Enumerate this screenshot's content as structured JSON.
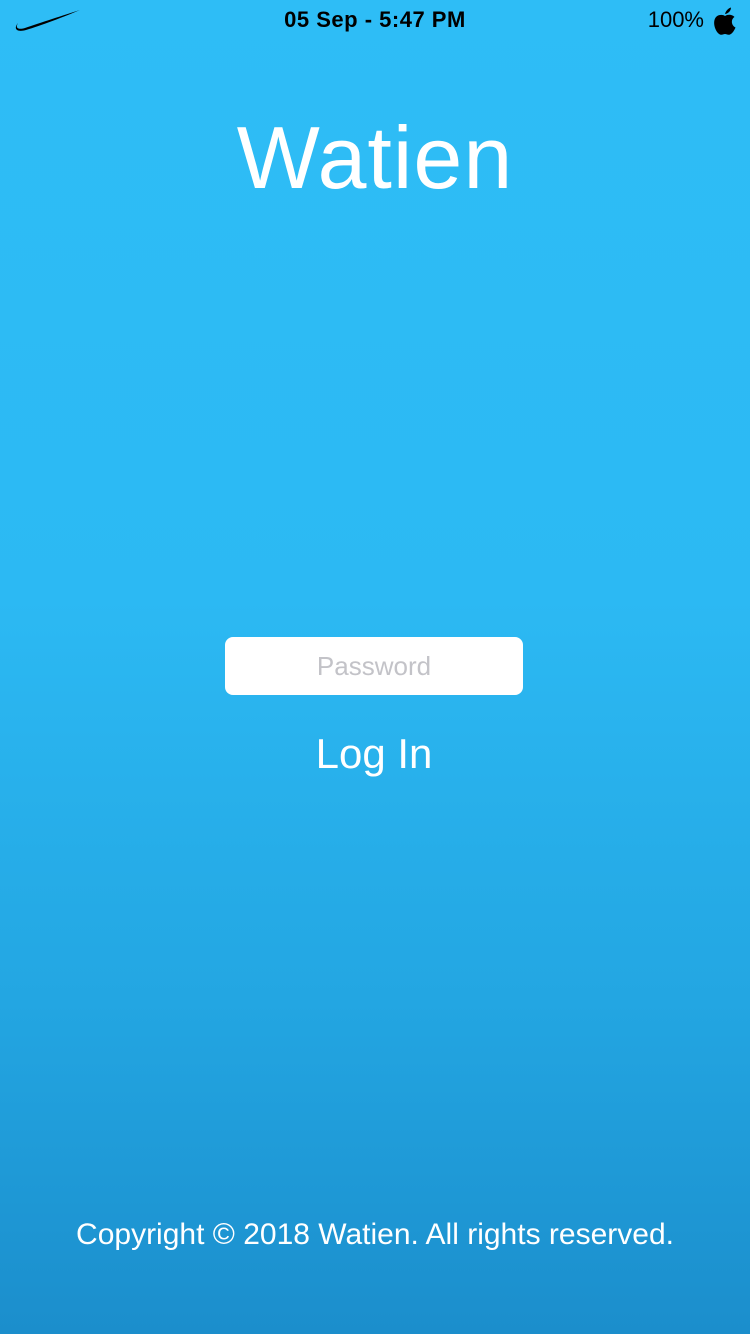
{
  "status_bar": {
    "time": "05 Sep - 5:47 PM",
    "battery": "100%",
    "carrier_icon": "swoosh-icon",
    "status_icon": "apple-icon"
  },
  "app": {
    "title": "Watien"
  },
  "login_form": {
    "password_placeholder": "Password",
    "password_value": "",
    "login_label": "Log In"
  },
  "footer": {
    "copyright": "Copyright © 2018 Watien. All rights reserved."
  },
  "colors": {
    "background_top": "#2EBDF6",
    "background_bottom": "#1B8ECC",
    "text": "#FFFFFF",
    "field_background": "#FFFFFF",
    "placeholder": "#C3C3C8",
    "status_text": "#000000"
  }
}
